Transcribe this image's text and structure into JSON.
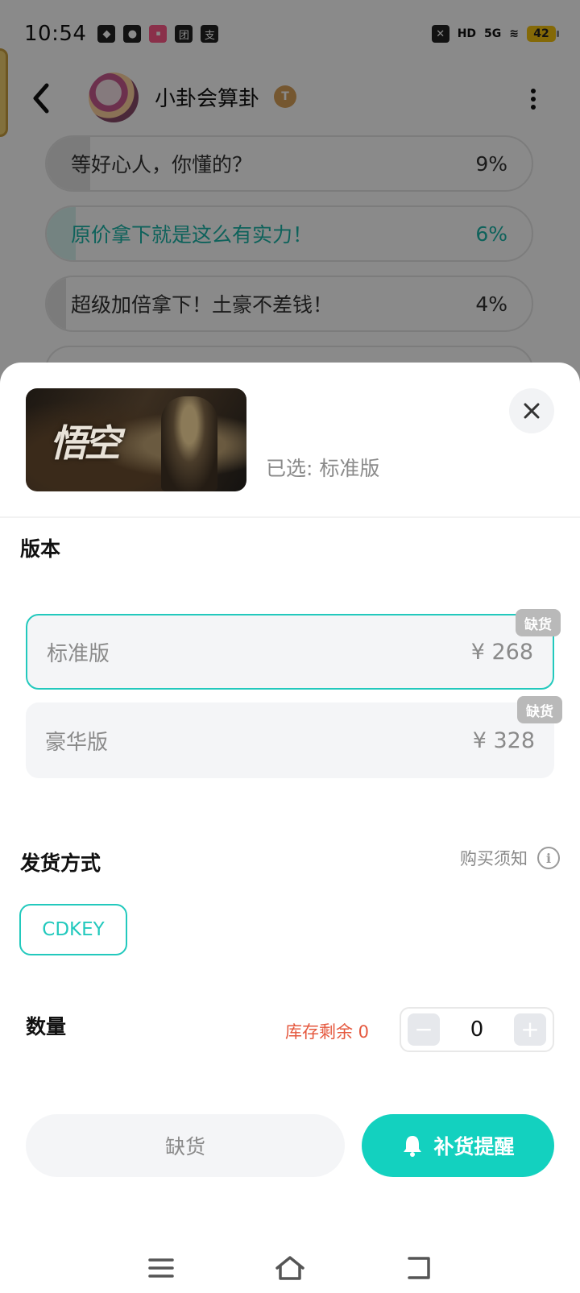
{
  "status_bar": {
    "time": "10:54",
    "left_icons": [
      "qq-icon",
      "wechat-icon",
      "app-icon",
      "tuan-icon",
      "pay-icon"
    ],
    "pay_glyph": "支",
    "tuan_glyph": "团",
    "network": "5G",
    "hd": "HD",
    "battery": "42"
  },
  "header": {
    "channel_name": "小卦会算卦",
    "badge": "T"
  },
  "poll": {
    "items": [
      {
        "label": "等好心人，你懂的？",
        "percent": "9%",
        "fill": 0.09
      },
      {
        "label": "原价拿下就是这么有实力！",
        "percent": "6%",
        "fill": 0.06,
        "selected": true
      },
      {
        "label": "超级加倍拿下！土豪不差钱！",
        "percent": "4%",
        "fill": 0.04
      }
    ]
  },
  "sheet": {
    "selected_label": "已选: 标准版",
    "version_title": "版本",
    "options": [
      {
        "name": "标准版",
        "price": "¥ 268",
        "tag": "缺货",
        "selected": true
      },
      {
        "name": "豪华版",
        "price": "¥ 328",
        "tag": "缺货",
        "selected": false
      }
    ],
    "delivery_title": "发货方式",
    "purchase_notice": "购买须知",
    "delivery_method": "CDKEY",
    "quantity_title": "数量",
    "stock_remaining": "库存剩余 0",
    "quantity_value": "0",
    "out_of_stock_button": "缺货",
    "restock_button": "补货提醒"
  },
  "colors": {
    "accent": "#13d1bf",
    "warning": "#e5583e",
    "tag_gray": "#b9b9b9"
  }
}
